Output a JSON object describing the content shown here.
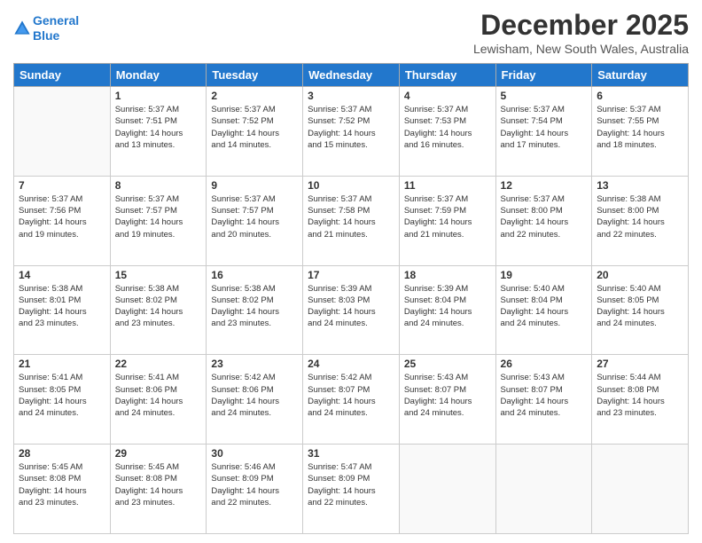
{
  "header": {
    "logo": {
      "line1": "General",
      "line2": "Blue"
    },
    "title": "December 2025",
    "location": "Lewisham, New South Wales, Australia"
  },
  "calendar": {
    "days_of_week": [
      "Sunday",
      "Monday",
      "Tuesday",
      "Wednesday",
      "Thursday",
      "Friday",
      "Saturday"
    ],
    "weeks": [
      [
        {
          "day": "",
          "info": ""
        },
        {
          "day": "1",
          "info": "Sunrise: 5:37 AM\nSunset: 7:51 PM\nDaylight: 14 hours\nand 13 minutes."
        },
        {
          "day": "2",
          "info": "Sunrise: 5:37 AM\nSunset: 7:52 PM\nDaylight: 14 hours\nand 14 minutes."
        },
        {
          "day": "3",
          "info": "Sunrise: 5:37 AM\nSunset: 7:52 PM\nDaylight: 14 hours\nand 15 minutes."
        },
        {
          "day": "4",
          "info": "Sunrise: 5:37 AM\nSunset: 7:53 PM\nDaylight: 14 hours\nand 16 minutes."
        },
        {
          "day": "5",
          "info": "Sunrise: 5:37 AM\nSunset: 7:54 PM\nDaylight: 14 hours\nand 17 minutes."
        },
        {
          "day": "6",
          "info": "Sunrise: 5:37 AM\nSunset: 7:55 PM\nDaylight: 14 hours\nand 18 minutes."
        }
      ],
      [
        {
          "day": "7",
          "info": "Sunrise: 5:37 AM\nSunset: 7:56 PM\nDaylight: 14 hours\nand 19 minutes."
        },
        {
          "day": "8",
          "info": "Sunrise: 5:37 AM\nSunset: 7:57 PM\nDaylight: 14 hours\nand 19 minutes."
        },
        {
          "day": "9",
          "info": "Sunrise: 5:37 AM\nSunset: 7:57 PM\nDaylight: 14 hours\nand 20 minutes."
        },
        {
          "day": "10",
          "info": "Sunrise: 5:37 AM\nSunset: 7:58 PM\nDaylight: 14 hours\nand 21 minutes."
        },
        {
          "day": "11",
          "info": "Sunrise: 5:37 AM\nSunset: 7:59 PM\nDaylight: 14 hours\nand 21 minutes."
        },
        {
          "day": "12",
          "info": "Sunrise: 5:37 AM\nSunset: 8:00 PM\nDaylight: 14 hours\nand 22 minutes."
        },
        {
          "day": "13",
          "info": "Sunrise: 5:38 AM\nSunset: 8:00 PM\nDaylight: 14 hours\nand 22 minutes."
        }
      ],
      [
        {
          "day": "14",
          "info": "Sunrise: 5:38 AM\nSunset: 8:01 PM\nDaylight: 14 hours\nand 23 minutes."
        },
        {
          "day": "15",
          "info": "Sunrise: 5:38 AM\nSunset: 8:02 PM\nDaylight: 14 hours\nand 23 minutes."
        },
        {
          "day": "16",
          "info": "Sunrise: 5:38 AM\nSunset: 8:02 PM\nDaylight: 14 hours\nand 23 minutes."
        },
        {
          "day": "17",
          "info": "Sunrise: 5:39 AM\nSunset: 8:03 PM\nDaylight: 14 hours\nand 24 minutes."
        },
        {
          "day": "18",
          "info": "Sunrise: 5:39 AM\nSunset: 8:04 PM\nDaylight: 14 hours\nand 24 minutes."
        },
        {
          "day": "19",
          "info": "Sunrise: 5:40 AM\nSunset: 8:04 PM\nDaylight: 14 hours\nand 24 minutes."
        },
        {
          "day": "20",
          "info": "Sunrise: 5:40 AM\nSunset: 8:05 PM\nDaylight: 14 hours\nand 24 minutes."
        }
      ],
      [
        {
          "day": "21",
          "info": "Sunrise: 5:41 AM\nSunset: 8:05 PM\nDaylight: 14 hours\nand 24 minutes."
        },
        {
          "day": "22",
          "info": "Sunrise: 5:41 AM\nSunset: 8:06 PM\nDaylight: 14 hours\nand 24 minutes."
        },
        {
          "day": "23",
          "info": "Sunrise: 5:42 AM\nSunset: 8:06 PM\nDaylight: 14 hours\nand 24 minutes."
        },
        {
          "day": "24",
          "info": "Sunrise: 5:42 AM\nSunset: 8:07 PM\nDaylight: 14 hours\nand 24 minutes."
        },
        {
          "day": "25",
          "info": "Sunrise: 5:43 AM\nSunset: 8:07 PM\nDaylight: 14 hours\nand 24 minutes."
        },
        {
          "day": "26",
          "info": "Sunrise: 5:43 AM\nSunset: 8:07 PM\nDaylight: 14 hours\nand 24 minutes."
        },
        {
          "day": "27",
          "info": "Sunrise: 5:44 AM\nSunset: 8:08 PM\nDaylight: 14 hours\nand 23 minutes."
        }
      ],
      [
        {
          "day": "28",
          "info": "Sunrise: 5:45 AM\nSunset: 8:08 PM\nDaylight: 14 hours\nand 23 minutes."
        },
        {
          "day": "29",
          "info": "Sunrise: 5:45 AM\nSunset: 8:08 PM\nDaylight: 14 hours\nand 23 minutes."
        },
        {
          "day": "30",
          "info": "Sunrise: 5:46 AM\nSunset: 8:09 PM\nDaylight: 14 hours\nand 22 minutes."
        },
        {
          "day": "31",
          "info": "Sunrise: 5:47 AM\nSunset: 8:09 PM\nDaylight: 14 hours\nand 22 minutes."
        },
        {
          "day": "",
          "info": ""
        },
        {
          "day": "",
          "info": ""
        },
        {
          "day": "",
          "info": ""
        }
      ]
    ]
  }
}
